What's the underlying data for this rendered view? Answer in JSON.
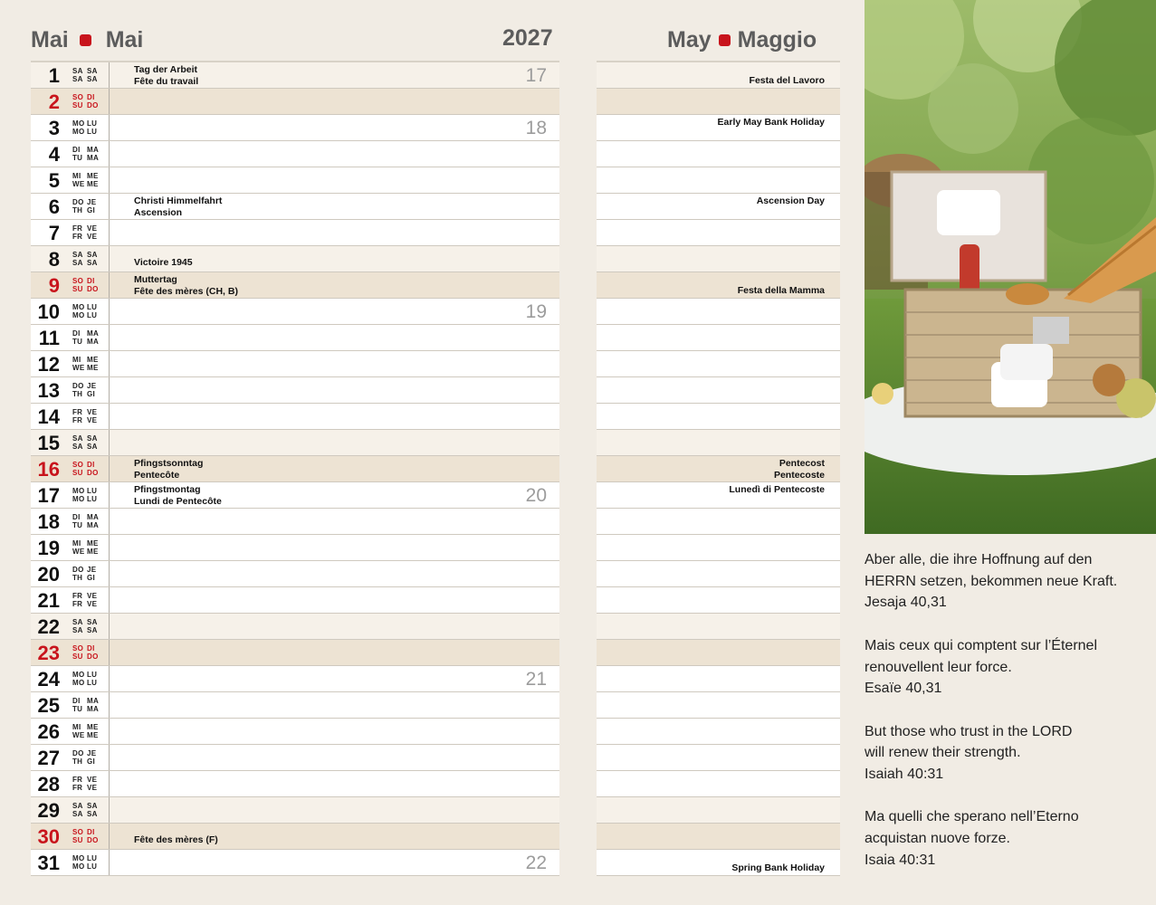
{
  "header": {
    "left_de": "Mai",
    "left_fr": "Mai",
    "year": "2027",
    "right_en": "May",
    "right_it": "Maggio"
  },
  "photo_icon": "picnic-basket-photo",
  "days": [
    {
      "num": "1",
      "type": "sat",
      "d1": [
        "SA",
        "SA"
      ],
      "d2": [
        "SA",
        "SA"
      ],
      "left": [
        "Tag der Arbeit",
        "Fête du travail"
      ],
      "week": "17",
      "right": [
        "Festa del Lavoro"
      ]
    },
    {
      "num": "2",
      "type": "sun",
      "d1": [
        "SO",
        "DI"
      ],
      "d2": [
        "SU",
        "DO"
      ],
      "left": [],
      "week": "",
      "right": []
    },
    {
      "num": "3",
      "type": "wd",
      "d1": [
        "MO",
        "LU"
      ],
      "d2": [
        "MO",
        "LU"
      ],
      "left": [],
      "week": "18",
      "right": [
        "Early May Bank Holiday"
      ],
      "rtop": true
    },
    {
      "num": "4",
      "type": "wd",
      "d1": [
        "DI",
        "MA"
      ],
      "d2": [
        "TU",
        "MA"
      ],
      "left": [],
      "week": "",
      "right": []
    },
    {
      "num": "5",
      "type": "wd",
      "d1": [
        "MI",
        "ME"
      ],
      "d2": [
        "WE",
        "ME"
      ],
      "left": [],
      "week": "",
      "right": []
    },
    {
      "num": "6",
      "type": "wd",
      "d1": [
        "DO",
        "JE"
      ],
      "d2": [
        "TH",
        "GI"
      ],
      "left": [
        "Christi Himmelfahrt",
        "Ascension"
      ],
      "week": "",
      "right": [
        "Ascension Day"
      ],
      "rtop": true
    },
    {
      "num": "7",
      "type": "wd",
      "d1": [
        "FR",
        "VE"
      ],
      "d2": [
        "FR",
        "VE"
      ],
      "left": [],
      "week": "",
      "right": []
    },
    {
      "num": "8",
      "type": "sat",
      "d1": [
        "SA",
        "SA"
      ],
      "d2": [
        "SA",
        "SA"
      ],
      "left": [
        "Victoire 1945"
      ],
      "week": "",
      "right": []
    },
    {
      "num": "9",
      "type": "sun",
      "d1": [
        "SO",
        "DI"
      ],
      "d2": [
        "SU",
        "DO"
      ],
      "left": [
        "Muttertag",
        "Fête des mères (CH, B)"
      ],
      "week": "",
      "right": [
        "Festa della Mamma"
      ]
    },
    {
      "num": "10",
      "type": "wd",
      "d1": [
        "MO",
        "LU"
      ],
      "d2": [
        "MO",
        "LU"
      ],
      "left": [],
      "week": "19",
      "right": []
    },
    {
      "num": "11",
      "type": "wd",
      "d1": [
        "DI",
        "MA"
      ],
      "d2": [
        "TU",
        "MA"
      ],
      "left": [],
      "week": "",
      "right": []
    },
    {
      "num": "12",
      "type": "wd",
      "d1": [
        "MI",
        "ME"
      ],
      "d2": [
        "WE",
        "ME"
      ],
      "left": [],
      "week": "",
      "right": []
    },
    {
      "num": "13",
      "type": "wd",
      "d1": [
        "DO",
        "JE"
      ],
      "d2": [
        "TH",
        "GI"
      ],
      "left": [],
      "week": "",
      "right": []
    },
    {
      "num": "14",
      "type": "wd",
      "d1": [
        "FR",
        "VE"
      ],
      "d2": [
        "FR",
        "VE"
      ],
      "left": [],
      "week": "",
      "right": []
    },
    {
      "num": "15",
      "type": "sat",
      "d1": [
        "SA",
        "SA"
      ],
      "d2": [
        "SA",
        "SA"
      ],
      "left": [],
      "week": "",
      "right": []
    },
    {
      "num": "16",
      "type": "sun",
      "d1": [
        "SO",
        "DI"
      ],
      "d2": [
        "SU",
        "DO"
      ],
      "left": [
        "Pfingstsonntag",
        "Pentecôte"
      ],
      "week": "",
      "right": [
        "Pentecost",
        "Pentecoste"
      ]
    },
    {
      "num": "17",
      "type": "wd",
      "d1": [
        "MO",
        "LU"
      ],
      "d2": [
        "MO",
        "LU"
      ],
      "left": [
        "Pfingstmontag",
        "Lundi de Pentecôte"
      ],
      "week": "20",
      "right": [
        "Lunedì di Pentecoste"
      ],
      "rtop": true
    },
    {
      "num": "18",
      "type": "wd",
      "d1": [
        "DI",
        "MA"
      ],
      "d2": [
        "TU",
        "MA"
      ],
      "left": [],
      "week": "",
      "right": []
    },
    {
      "num": "19",
      "type": "wd",
      "d1": [
        "MI",
        "ME"
      ],
      "d2": [
        "WE",
        "ME"
      ],
      "left": [],
      "week": "",
      "right": []
    },
    {
      "num": "20",
      "type": "wd",
      "d1": [
        "DO",
        "JE"
      ],
      "d2": [
        "TH",
        "GI"
      ],
      "left": [],
      "week": "",
      "right": []
    },
    {
      "num": "21",
      "type": "wd",
      "d1": [
        "FR",
        "VE"
      ],
      "d2": [
        "FR",
        "VE"
      ],
      "left": [],
      "week": "",
      "right": []
    },
    {
      "num": "22",
      "type": "sat",
      "d1": [
        "SA",
        "SA"
      ],
      "d2": [
        "SA",
        "SA"
      ],
      "left": [],
      "week": "",
      "right": []
    },
    {
      "num": "23",
      "type": "sun",
      "d1": [
        "SO",
        "DI"
      ],
      "d2": [
        "SU",
        "DO"
      ],
      "left": [],
      "week": "",
      "right": []
    },
    {
      "num": "24",
      "type": "wd",
      "d1": [
        "MO",
        "LU"
      ],
      "d2": [
        "MO",
        "LU"
      ],
      "left": [],
      "week": "21",
      "right": []
    },
    {
      "num": "25",
      "type": "wd",
      "d1": [
        "DI",
        "MA"
      ],
      "d2": [
        "TU",
        "MA"
      ],
      "left": [],
      "week": "",
      "right": []
    },
    {
      "num": "26",
      "type": "wd",
      "d1": [
        "MI",
        "ME"
      ],
      "d2": [
        "WE",
        "ME"
      ],
      "left": [],
      "week": "",
      "right": []
    },
    {
      "num": "27",
      "type": "wd",
      "d1": [
        "DO",
        "JE"
      ],
      "d2": [
        "TH",
        "GI"
      ],
      "left": [],
      "week": "",
      "right": []
    },
    {
      "num": "28",
      "type": "wd",
      "d1": [
        "FR",
        "VE"
      ],
      "d2": [
        "FR",
        "VE"
      ],
      "left": [],
      "week": "",
      "right": []
    },
    {
      "num": "29",
      "type": "sat",
      "d1": [
        "SA",
        "SA"
      ],
      "d2": [
        "SA",
        "SA"
      ],
      "left": [],
      "week": "",
      "right": []
    },
    {
      "num": "30",
      "type": "sun",
      "d1": [
        "SO",
        "DI"
      ],
      "d2": [
        "SU",
        "DO"
      ],
      "left": [
        "Fête des mères (F)"
      ],
      "week": "",
      "right": []
    },
    {
      "num": "31",
      "type": "wd",
      "d1": [
        "MO",
        "LU"
      ],
      "d2": [
        "MO",
        "LU"
      ],
      "left": [],
      "week": "22",
      "right": [
        "Spring Bank Holiday"
      ]
    }
  ],
  "quotes": [
    {
      "lines": [
        "Aber alle, die ihre Hoffnung auf den",
        "HERRN setzen, bekommen neue Kraft.",
        "Jesaja 40,31"
      ]
    },
    {
      "lines": [
        "Mais ceux qui comptent sur l’Éternel",
        "renouvellent leur force.",
        "Esaïe 40,31"
      ]
    },
    {
      "lines": [
        "But those who trust in the LORD",
        "will renew their strength.",
        "Isaiah 40:31"
      ]
    },
    {
      "lines": [
        "Ma quelli che sperano nell’Eterno",
        "acquistan nuove forze.",
        "Isaia 40:31"
      ]
    }
  ]
}
